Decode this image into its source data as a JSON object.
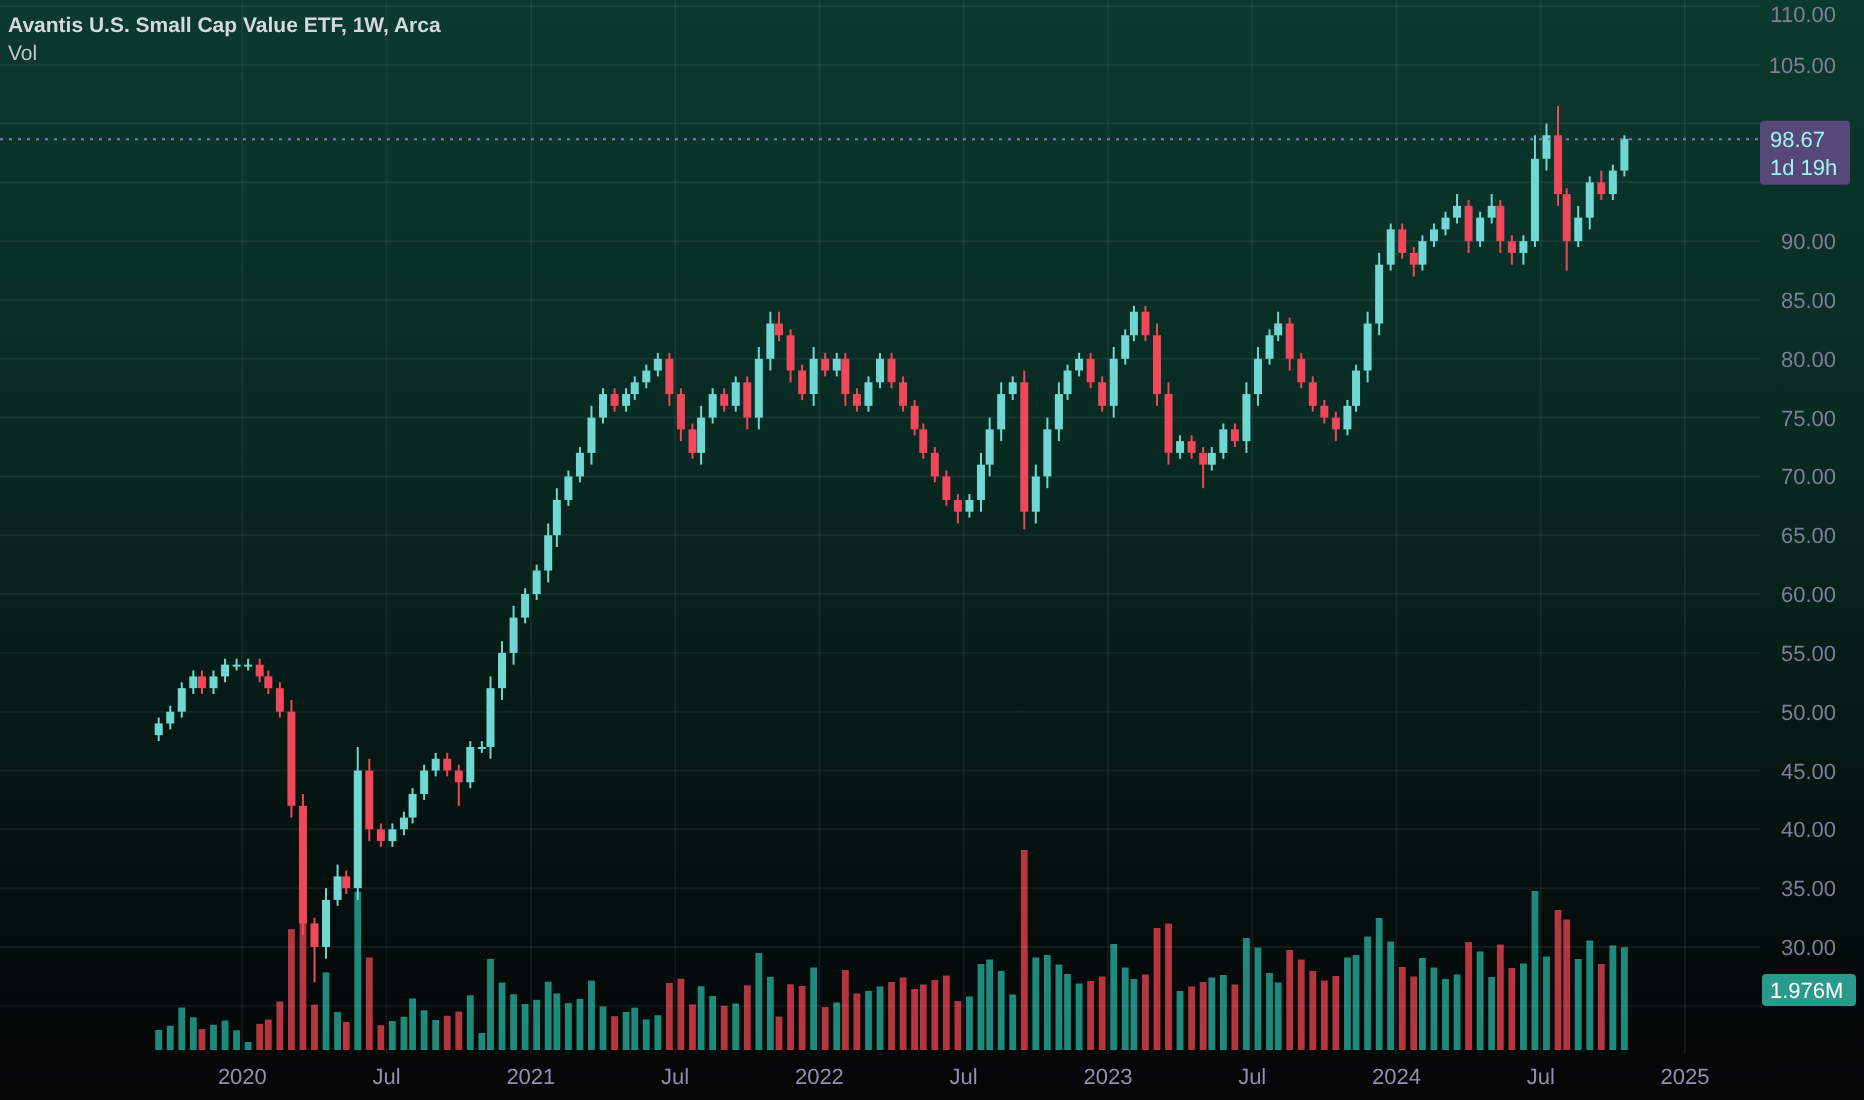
{
  "chart": {
    "title": "Avantis U.S. Small Cap Value ETF, 1W, Arca",
    "volume_label": "Vol",
    "price_badge": {
      "price": "98.67",
      "countdown": "1d 19h"
    },
    "volume_badge": "1.976M",
    "chart_data": {
      "type": "candlestick",
      "ylim": [
        20.9,
        110.5
      ],
      "grid": true,
      "ref_lines": [
        {
          "axis": "y",
          "value": 98.67
        }
      ],
      "xlim": [
        2019.16,
        2025.26
      ],
      "x": [
        2019.71,
        2019.75,
        2019.79,
        2019.83,
        2019.86,
        2019.9,
        2019.94,
        2019.98,
        2020.02,
        2020.06,
        2020.09,
        2020.13,
        2020.17,
        2020.21,
        2020.25,
        2020.29,
        2020.33,
        2020.36,
        2020.4,
        2020.44,
        2020.48,
        2020.52,
        2020.56,
        2020.59,
        2020.63,
        2020.67,
        2020.71,
        2020.75,
        2020.79,
        2020.83,
        2020.86,
        2020.9,
        2020.94,
        2020.98,
        2021.02,
        2021.06,
        2021.09,
        2021.13,
        2021.17,
        2021.21,
        2021.25,
        2021.29,
        2021.33,
        2021.36,
        2021.4,
        2021.44,
        2021.48,
        2021.52,
        2021.56,
        2021.59,
        2021.63,
        2021.67,
        2021.71,
        2021.75,
        2021.79,
        2021.83,
        2021.86,
        2021.9,
        2021.94,
        2021.98,
        2022.02,
        2022.06,
        2022.09,
        2022.13,
        2022.17,
        2022.21,
        2022.25,
        2022.29,
        2022.33,
        2022.36,
        2022.4,
        2022.44,
        2022.48,
        2022.52,
        2022.56,
        2022.59,
        2022.63,
        2022.67,
        2022.71,
        2022.75,
        2022.79,
        2022.83,
        2022.86,
        2022.9,
        2022.94,
        2022.98,
        2023.02,
        2023.06,
        2023.09,
        2023.13,
        2023.17,
        2023.21,
        2023.25,
        2023.29,
        2023.33,
        2023.36,
        2023.4,
        2023.44,
        2023.48,
        2023.52,
        2023.56,
        2023.59,
        2023.63,
        2023.67,
        2023.71,
        2023.75,
        2023.79,
        2023.83,
        2023.86,
        2023.9,
        2023.94,
        2023.98,
        2024.02,
        2024.06,
        2024.09,
        2024.13,
        2024.17,
        2024.21,
        2024.25,
        2024.29,
        2024.33,
        2024.36,
        2024.4,
        2024.44,
        2024.48,
        2024.52,
        2024.56,
        2024.59,
        2024.63,
        2024.67,
        2024.71,
        2024.75,
        2024.79
      ],
      "ohlc": [
        [
          48,
          49.5,
          47.5,
          49
        ],
        [
          49,
          50.5,
          48.5,
          50
        ],
        [
          50,
          52.5,
          49.5,
          52
        ],
        [
          52,
          53.5,
          51.5,
          53
        ],
        [
          53,
          53.5,
          51.5,
          52
        ],
        [
          52,
          53.5,
          51.5,
          53
        ],
        [
          53,
          54.5,
          52.5,
          54
        ],
        [
          54,
          54.5,
          53.5,
          54
        ],
        [
          54,
          54.5,
          53.5,
          54
        ],
        [
          54,
          54.5,
          52.5,
          53
        ],
        [
          53,
          53.5,
          51.5,
          52
        ],
        [
          52,
          52.5,
          49.5,
          50
        ],
        [
          50,
          51,
          41,
          42
        ],
        [
          42,
          43,
          31,
          32
        ],
        [
          32,
          32.5,
          27,
          30
        ],
        [
          30,
          35,
          29,
          34
        ],
        [
          34,
          37,
          33.5,
          36
        ],
        [
          36,
          36.5,
          34.5,
          35
        ],
        [
          35,
          47,
          34,
          45
        ],
        [
          45,
          46,
          39,
          40
        ],
        [
          40,
          40.5,
          38.5,
          39
        ],
        [
          39,
          40.5,
          38.5,
          40
        ],
        [
          40,
          41.5,
          39.5,
          41
        ],
        [
          41,
          43.5,
          40.5,
          43
        ],
        [
          43,
          45.5,
          42.5,
          45
        ],
        [
          45,
          46.5,
          44.5,
          46
        ],
        [
          46,
          46.5,
          44.5,
          45
        ],
        [
          45,
          45.5,
          42,
          44
        ],
        [
          44,
          47.5,
          43.5,
          47
        ],
        [
          47,
          47.5,
          46.5,
          47
        ],
        [
          47,
          53,
          46,
          52
        ],
        [
          52,
          56,
          51,
          55
        ],
        [
          55,
          59,
          54,
          58
        ],
        [
          58,
          60.5,
          57.5,
          60
        ],
        [
          60,
          62.5,
          59.5,
          62
        ],
        [
          62,
          66,
          61,
          65
        ],
        [
          65,
          69,
          64,
          68
        ],
        [
          68,
          70.5,
          67.5,
          70
        ],
        [
          70,
          72.5,
          69.5,
          72
        ],
        [
          72,
          76,
          71,
          75
        ],
        [
          75,
          77.5,
          74.5,
          77
        ],
        [
          77,
          77.5,
          75.5,
          76
        ],
        [
          76,
          77.5,
          75.5,
          77
        ],
        [
          77,
          78.5,
          76.5,
          78
        ],
        [
          78,
          79.5,
          77.5,
          79
        ],
        [
          79,
          80.5,
          78.5,
          80
        ],
        [
          80,
          80.5,
          76,
          77
        ],
        [
          77,
          77.5,
          73,
          74
        ],
        [
          74,
          74.5,
          71.5,
          72
        ],
        [
          72,
          76,
          71,
          75
        ],
        [
          75,
          77.5,
          74.5,
          77
        ],
        [
          77,
          77.5,
          75.5,
          76
        ],
        [
          76,
          78.5,
          75.5,
          78
        ],
        [
          78,
          78.5,
          74,
          75
        ],
        [
          75,
          81,
          74,
          80
        ],
        [
          80,
          84,
          79,
          83
        ],
        [
          83,
          84,
          81.5,
          82
        ],
        [
          82,
          82.5,
          78,
          79
        ],
        [
          79,
          79.5,
          76.5,
          77
        ],
        [
          77,
          81,
          76,
          80
        ],
        [
          80,
          80.5,
          78.5,
          79
        ],
        [
          79,
          80.5,
          78.5,
          80
        ],
        [
          80,
          80.5,
          76,
          77
        ],
        [
          77,
          77.5,
          75.5,
          76
        ],
        [
          76,
          78.5,
          75.5,
          78
        ],
        [
          78,
          80.5,
          77.5,
          80
        ],
        [
          80,
          80.5,
          77.5,
          78
        ],
        [
          78,
          78.5,
          75.5,
          76
        ],
        [
          76,
          76.5,
          73.5,
          74
        ],
        [
          74,
          74.5,
          71.5,
          72
        ],
        [
          72,
          72.5,
          69.5,
          70
        ],
        [
          70,
          70.5,
          67.5,
          68
        ],
        [
          68,
          68.5,
          66,
          67
        ],
        [
          67,
          68.5,
          66.5,
          68
        ],
        [
          68,
          72,
          67,
          71
        ],
        [
          71,
          75,
          70,
          74
        ],
        [
          74,
          78,
          73,
          77
        ],
        [
          77,
          78.5,
          76.5,
          78
        ],
        [
          78,
          79,
          65.5,
          67
        ],
        [
          67,
          71,
          66,
          70
        ],
        [
          70,
          75,
          69,
          74
        ],
        [
          74,
          78,
          73,
          77
        ],
        [
          77,
          79.5,
          76.5,
          79
        ],
        [
          79,
          80.5,
          78.5,
          80
        ],
        [
          80,
          80.5,
          77.5,
          78
        ],
        [
          78,
          78.5,
          75.5,
          76
        ],
        [
          76,
          81,
          75,
          80
        ],
        [
          80,
          82.5,
          79.5,
          82
        ],
        [
          82,
          84.5,
          81.5,
          84
        ],
        [
          84,
          84.5,
          81.5,
          82
        ],
        [
          82,
          83,
          76,
          77
        ],
        [
          77,
          78,
          71,
          72
        ],
        [
          72,
          73.5,
          71.5,
          73
        ],
        [
          73,
          73.5,
          71.5,
          72
        ],
        [
          72,
          72.5,
          69,
          71
        ],
        [
          71,
          72.5,
          70.5,
          72
        ],
        [
          72,
          74.5,
          71.5,
          74
        ],
        [
          74,
          74.5,
          72.5,
          73
        ],
        [
          73,
          78,
          72,
          77
        ],
        [
          77,
          81,
          76,
          80
        ],
        [
          80,
          82.5,
          79.5,
          82
        ],
        [
          82,
          84,
          81.5,
          83
        ],
        [
          83,
          83.5,
          79,
          80
        ],
        [
          80,
          80.5,
          77.5,
          78
        ],
        [
          78,
          78.5,
          75.5,
          76
        ],
        [
          76,
          76.5,
          74.5,
          75
        ],
        [
          75,
          75.5,
          73,
          74
        ],
        [
          74,
          76.5,
          73.5,
          76
        ],
        [
          76,
          79.5,
          75.5,
          79
        ],
        [
          79,
          84,
          78,
          83
        ],
        [
          83,
          89,
          82,
          88
        ],
        [
          88,
          91.5,
          87.5,
          91
        ],
        [
          91,
          91.5,
          88.5,
          89
        ],
        [
          89,
          89.5,
          87,
          88
        ],
        [
          88,
          90.5,
          87.5,
          90
        ],
        [
          90,
          91.5,
          89.5,
          91
        ],
        [
          91,
          92.5,
          90.5,
          92
        ],
        [
          92,
          94,
          91.5,
          93
        ],
        [
          93,
          93.5,
          89,
          90
        ],
        [
          90,
          92.5,
          89.5,
          92
        ],
        [
          92,
          94,
          91.5,
          93
        ],
        [
          93,
          93.5,
          89,
          90
        ],
        [
          90,
          90.5,
          88,
          89
        ],
        [
          89,
          90.5,
          88,
          90
        ],
        [
          90,
          99,
          89.5,
          97
        ],
        [
          97,
          100,
          96,
          99
        ],
        [
          99,
          101.5,
          93,
          94
        ],
        [
          94,
          94.5,
          87.5,
          90
        ],
        [
          90,
          93,
          89.5,
          92
        ],
        [
          92,
          95.5,
          91,
          95
        ],
        [
          95,
          96,
          93.5,
          94
        ],
        [
          94,
          96.5,
          93.5,
          96
        ],
        [
          96,
          99,
          95.5,
          98.7
        ]
      ],
      "yticks": [
        {
          "value": 110,
          "label": "110.00"
        },
        {
          "value": 105,
          "label": "105.00"
        },
        {
          "value": 90,
          "label": "90.00"
        },
        {
          "value": 85,
          "label": "85.00"
        },
        {
          "value": 80,
          "label": "80.00"
        },
        {
          "value": 75,
          "label": "75.00"
        },
        {
          "value": 70,
          "label": "70.00"
        },
        {
          "value": 65,
          "label": "65.00"
        },
        {
          "value": 60,
          "label": "60.00"
        },
        {
          "value": 55,
          "label": "55.00"
        },
        {
          "value": 50,
          "label": "50.00"
        },
        {
          "value": 45,
          "label": "45.00"
        },
        {
          "value": 40,
          "label": "40.00"
        },
        {
          "value": 35,
          "label": "35.00"
        },
        {
          "value": 30,
          "label": "30.00"
        }
      ],
      "xticks": [
        {
          "value": 2020,
          "label": "2020"
        },
        {
          "value": 2020.5,
          "label": "Jul"
        },
        {
          "value": 2021,
          "label": "2021"
        },
        {
          "value": 2021.5,
          "label": "Jul"
        },
        {
          "value": 2022,
          "label": "2022"
        },
        {
          "value": 2022.5,
          "label": "Jul"
        },
        {
          "value": 2023,
          "label": "2023"
        },
        {
          "value": 2023.5,
          "label": "Jul"
        },
        {
          "value": 2024,
          "label": "2024"
        },
        {
          "value": 2024.5,
          "label": "Jul"
        },
        {
          "value": 2025,
          "label": "2025"
        }
      ]
    }
  }
}
